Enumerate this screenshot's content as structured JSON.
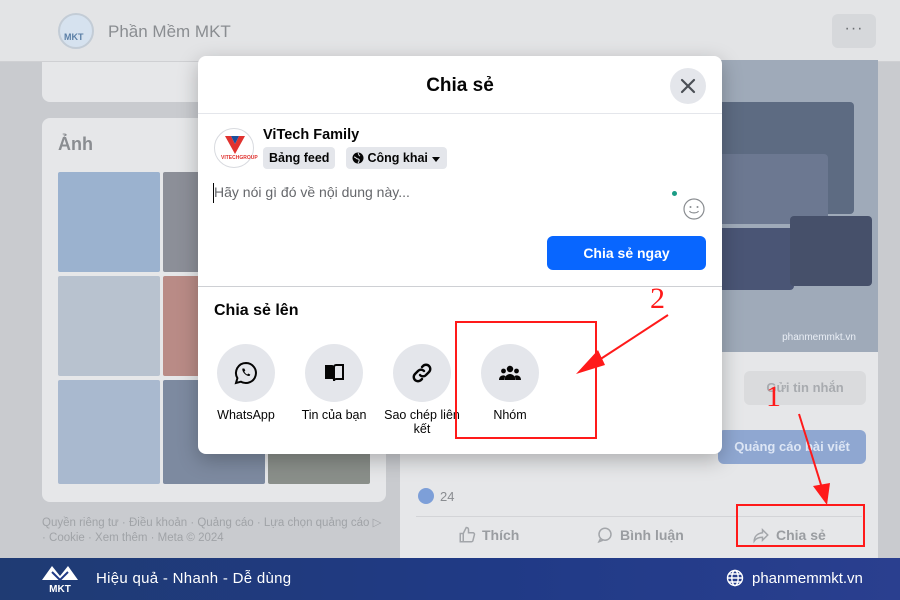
{
  "header": {
    "page_name": "Phần Mềm MKT",
    "more_label": "···"
  },
  "left": {
    "photos_title": "Ảnh",
    "footer_text": "Quyền riêng tư · Điều khoản · Quảng cáo · Lựa chọn quảng cáo ▷ · Cookie · Xem thêm · Meta © 2024"
  },
  "right": {
    "cover_brand": "phanmemmkt.vn",
    "message_button": "Gửi tin nhắn",
    "ads_button": "Quảng cáo bài viết",
    "like_count": "24",
    "actions": {
      "like": "Thích",
      "comment": "Bình luận",
      "share": "Chia sẻ"
    }
  },
  "modal": {
    "title": "Chia sẻ",
    "user_name": "ViTech Family",
    "avatar_text": "VITECHGROUP",
    "feed_pill": "Bảng feed",
    "audience_pill": "Công khai",
    "input_placeholder": "Hãy nói gì đó về nội dung này...",
    "share_now_button": "Chia sẻ ngay",
    "share_to_title": "Chia sẻ lên",
    "options": [
      {
        "label": "WhatsApp",
        "icon": "whatsapp-icon"
      },
      {
        "label": "Tin của bạn",
        "icon": "book-icon"
      },
      {
        "label": "Sao chép liên kết",
        "icon": "link-icon"
      },
      {
        "label": "Nhóm",
        "icon": "group-icon"
      }
    ]
  },
  "annotations": {
    "step1": "1",
    "step2": "2"
  },
  "banner": {
    "logo_text": "MKT",
    "tagline": "Hiệu quả - Nhanh - Dễ dùng",
    "website": "phanmemmkt.vn"
  },
  "colors": {
    "primary_blue": "#0866ff",
    "annotation_red": "#ff1a1a",
    "banner_blue": "#203a86"
  }
}
